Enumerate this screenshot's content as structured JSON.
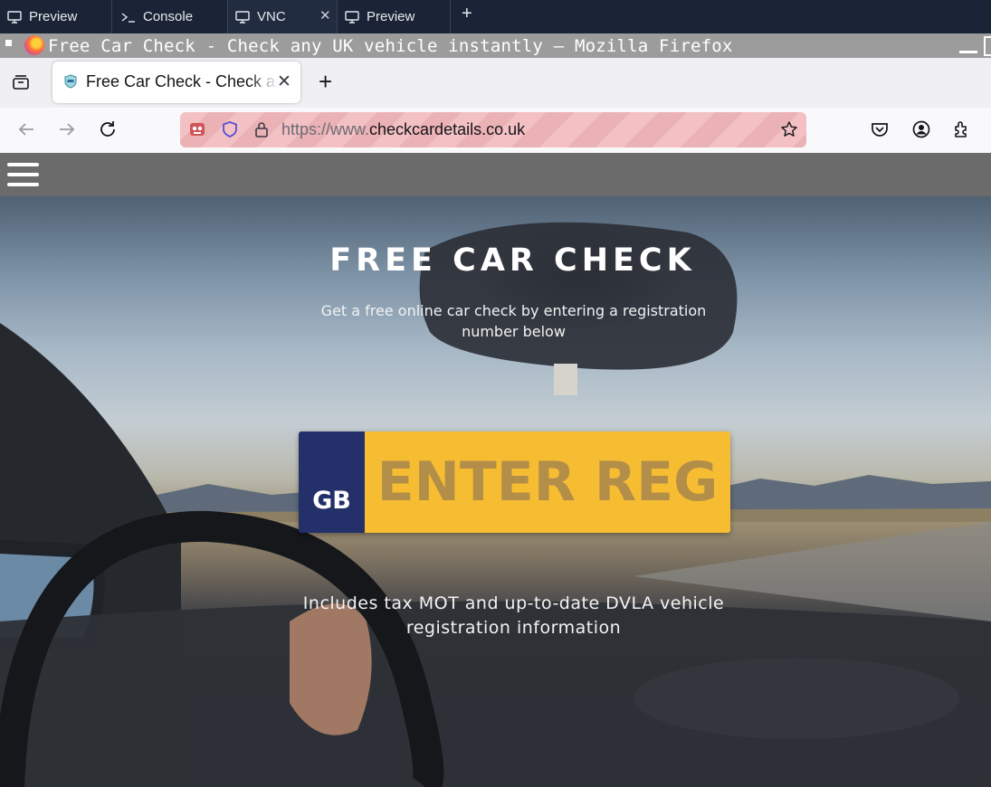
{
  "host_tabs": [
    {
      "label": "Preview",
      "icon": "monitor-icon"
    },
    {
      "label": "Console",
      "icon": "terminal-icon"
    },
    {
      "label": "VNC",
      "icon": "monitor-icon",
      "active": true
    },
    {
      "label": "Preview",
      "icon": "monitor-icon"
    }
  ],
  "window": {
    "title": "Free Car Check - Check any UK vehicle instantly — Mozilla Firefox"
  },
  "browser": {
    "tab_title": "Free Car Check - Check any UK vehicle instantly",
    "url_prefix": "https://www.",
    "url_domain": "checkcardetails.co.uk"
  },
  "page": {
    "hero_title": "FREE CAR CHECK",
    "hero_subtitle": "Get a free online car check by entering a registration number below",
    "plate_country": "GB",
    "plate_placeholder": "ENTER REG",
    "hero_footer": "Includes tax MOT and up-to-date DVLA vehicle registration information"
  },
  "colors": {
    "plate_yellow": "#f7bd32",
    "plate_blue": "#23306a",
    "private_url_bar": "#f3c1c3"
  }
}
